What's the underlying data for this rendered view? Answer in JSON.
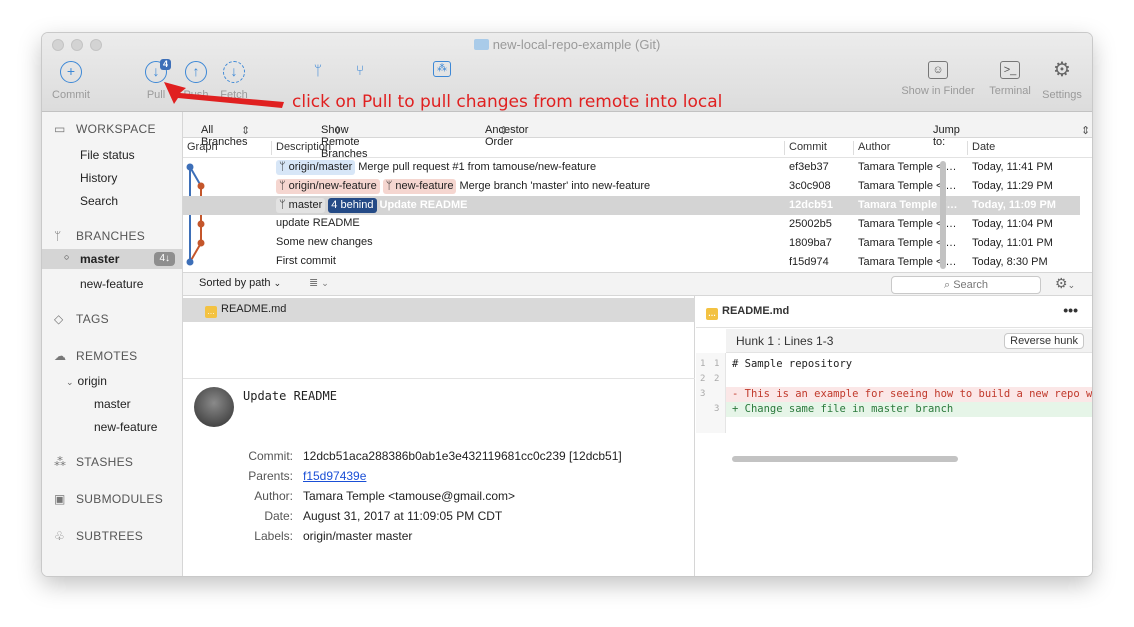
{
  "window": {
    "title": "new-local-repo-example (Git)"
  },
  "toolbar": {
    "commit": "Commit",
    "pull": "Pull",
    "pull_badge": "4",
    "push": "Push",
    "fetch": "Fetch",
    "show_in_finder": "Show in Finder",
    "terminal": "Terminal",
    "settings": "Settings"
  },
  "annotation": {
    "text": "click on Pull to pull changes from remote into local",
    "color": "#e02020"
  },
  "sidebar": {
    "workspace": "WORKSPACE",
    "file_status": "File status",
    "history": "History",
    "search": "Search",
    "branches": "BRANCHES",
    "master": "master",
    "master_badge": "4↓",
    "new_feature": "new-feature",
    "tags": "TAGS",
    "remotes": "REMOTES",
    "origin": "origin",
    "origin_master": "master",
    "origin_new_feature": "new-feature",
    "stashes": "STASHES",
    "submodules": "SUBMODULES",
    "subtrees": "SUBTREES"
  },
  "filters": {
    "all_branches": "All Branches",
    "show_remote": "Show Remote Branches",
    "ancestor": "Ancestor Order",
    "jump_to": "Jump to:"
  },
  "columns": {
    "graph": "Graph",
    "description": "Description",
    "commit": "Commit",
    "author": "Author",
    "date": "Date"
  },
  "commits": [
    {
      "tags": [
        {
          "label": "origin/master",
          "style": "blue"
        }
      ],
      "desc": "Merge pull request #1 from tamouse/new-feature",
      "hash": "ef3eb37",
      "author": "Tamara Temple <t…",
      "date": "Today, 11:41 PM"
    },
    {
      "tags": [
        {
          "label": "origin/new-feature",
          "style": "red"
        },
        {
          "label": "new-feature",
          "style": "red"
        }
      ],
      "desc": "Merge branch 'master' into new-feature",
      "hash": "3c0c908",
      "author": "Tamara Temple <t…",
      "date": "Today, 11:29 PM"
    },
    {
      "tags": [
        {
          "label": "master",
          "style": "gray"
        },
        {
          "label": "4 behind",
          "style": "dark"
        }
      ],
      "desc": "Update README",
      "hash": "12dcb51",
      "author": "Tamara Temple <…",
      "date": "Today, 11:09 PM",
      "selected": true
    },
    {
      "tags": [],
      "desc": "update README",
      "hash": "25002b5",
      "author": "Tamara Temple <t…",
      "date": "Today, 11:04 PM"
    },
    {
      "tags": [],
      "desc": "Some new changes",
      "hash": "1809ba7",
      "author": "Tamara Temple <t…",
      "date": "Today, 11:01 PM"
    },
    {
      "tags": [],
      "desc": "First commit",
      "hash": "f15d974",
      "author": "Tamara Temple <t…",
      "date": "Today, 8:30 PM"
    }
  ],
  "files": {
    "sort": "Sorted by path",
    "search_placeholder": "Search",
    "file": "README.md"
  },
  "details": {
    "message": "Update README",
    "commit_label": "Commit:",
    "commit_value": "12dcb51aca288386b0ab1e3e432119681cc0c239 [12dcb51]",
    "parents_label": "Parents:",
    "parents_value": "f15d97439e",
    "author_label": "Author:",
    "author_value": "Tamara Temple <tamouse@gmail.com>",
    "date_label": "Date:",
    "date_value": "August 31, 2017 at 11:09:05 PM CDT",
    "labels_label": "Labels:",
    "labels_value": "origin/master master"
  },
  "diff": {
    "file": "README.md",
    "hunk": "Hunk 1 : Lines 1-3",
    "reverse": "Reverse hunk",
    "lines": [
      {
        "old": "1",
        "new": "1",
        "text": "  # Sample repository",
        "type": "ctx"
      },
      {
        "old": "2",
        "new": "2",
        "text": "",
        "type": "ctx"
      },
      {
        "old": "3",
        "new": "",
        "text": "- This is an example for seeing how to build a new repo with",
        "type": "del"
      },
      {
        "old": "",
        "new": "3",
        "text": "+ Change same file in master branch",
        "type": "add"
      }
    ]
  }
}
